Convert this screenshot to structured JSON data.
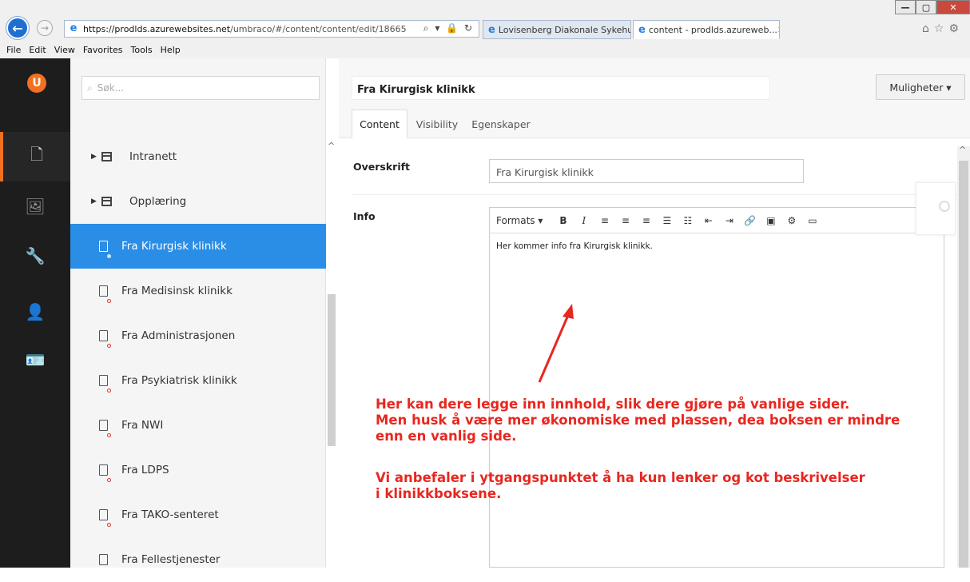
{
  "browser": {
    "url_host": "https://prodlds.azurewebsites.net",
    "url_path": "/umbraco/#/content/content/edit/18665",
    "addr_tools": "⌕ ▾ 🔒 ↻",
    "tabs": [
      {
        "label": "Lovisenberg Diakonale Sykehus"
      },
      {
        "label": "content - prodlds.azureweb...",
        "close": "✕"
      }
    ],
    "menu": [
      "File",
      "Edit",
      "View",
      "Favorites",
      "Tools",
      "Help"
    ],
    "window_controls": {
      "minimize": "—",
      "maximize": "▢",
      "close": "✕"
    }
  },
  "umbraco": {
    "logo": "U",
    "sections": [
      {
        "icon": "document-icon",
        "glyph": "🗋",
        "active": true
      },
      {
        "icon": "media-icon",
        "glyph": "🖼",
        "active": false
      },
      {
        "icon": "settings-wrench-icon",
        "glyph": "🔧",
        "active": false
      },
      {
        "icon": "users-icon",
        "glyph": "👤",
        "active": false
      },
      {
        "icon": "members-icon",
        "glyph": "🪪",
        "active": false
      }
    ]
  },
  "tree": {
    "search_placeholder": "Søk...",
    "items": [
      {
        "label": "Intranett",
        "type": "folder"
      },
      {
        "label": "Opplæring",
        "type": "folder"
      },
      {
        "label": "Fra Kirurgisk klinikk",
        "type": "doc",
        "selected": true
      },
      {
        "label": "Fra Medisinsk klinikk",
        "type": "doc"
      },
      {
        "label": "Fra Administrasjonen",
        "type": "doc"
      },
      {
        "label": "Fra Psykiatrisk klinikk",
        "type": "doc"
      },
      {
        "label": "Fra NWI",
        "type": "doc"
      },
      {
        "label": "Fra LDPS",
        "type": "doc"
      },
      {
        "label": "Fra TAKO-senteret",
        "type": "doc"
      },
      {
        "label": "Fra Fellestjenester",
        "type": "doc"
      }
    ]
  },
  "editor": {
    "node_name": "Fra Kirurgisk klinikk",
    "options_label": "Muligheter ▾",
    "tabs": [
      "Content",
      "Visibility",
      "Egenskaper"
    ],
    "props": {
      "overskrift_label": "Overskrift",
      "overskrift_value": "Fra Kirurgisk klinikk",
      "info_label": "Info"
    },
    "rte": {
      "formats": "Formats ▾",
      "buttons": [
        {
          "name": "bold-button",
          "glyph": "B"
        },
        {
          "name": "italic-button",
          "glyph": "I"
        },
        {
          "name": "align-left-button",
          "glyph": "≡"
        },
        {
          "name": "align-center-button",
          "glyph": "≡"
        },
        {
          "name": "align-right-button",
          "glyph": "≡"
        },
        {
          "name": "bullet-list-button",
          "glyph": "☰"
        },
        {
          "name": "numbered-list-button",
          "glyph": "☷"
        },
        {
          "name": "outdent-button",
          "glyph": "⇤"
        },
        {
          "name": "indent-button",
          "glyph": "⇥"
        },
        {
          "name": "link-button",
          "glyph": "🔗"
        },
        {
          "name": "image-button",
          "glyph": "▣"
        },
        {
          "name": "macro-button",
          "glyph": "⚙"
        },
        {
          "name": "embed-button",
          "glyph": "▭"
        }
      ],
      "body": "Her kommer info fra Kirurgisk klinikk."
    }
  },
  "annotation": {
    "color": "#e8271f",
    "lines": [
      "Her kan dere legge inn innhold, slik dere gjøre på vanlige sider.",
      "Men husk å være mer økonomiske med plassen, dea boksen er mindre",
      "enn en vanlig side.",
      "Vi anbefaler i ytgangspunktet å ha kun lenker og kot beskrivelser",
      "i klinikkboksene."
    ]
  }
}
